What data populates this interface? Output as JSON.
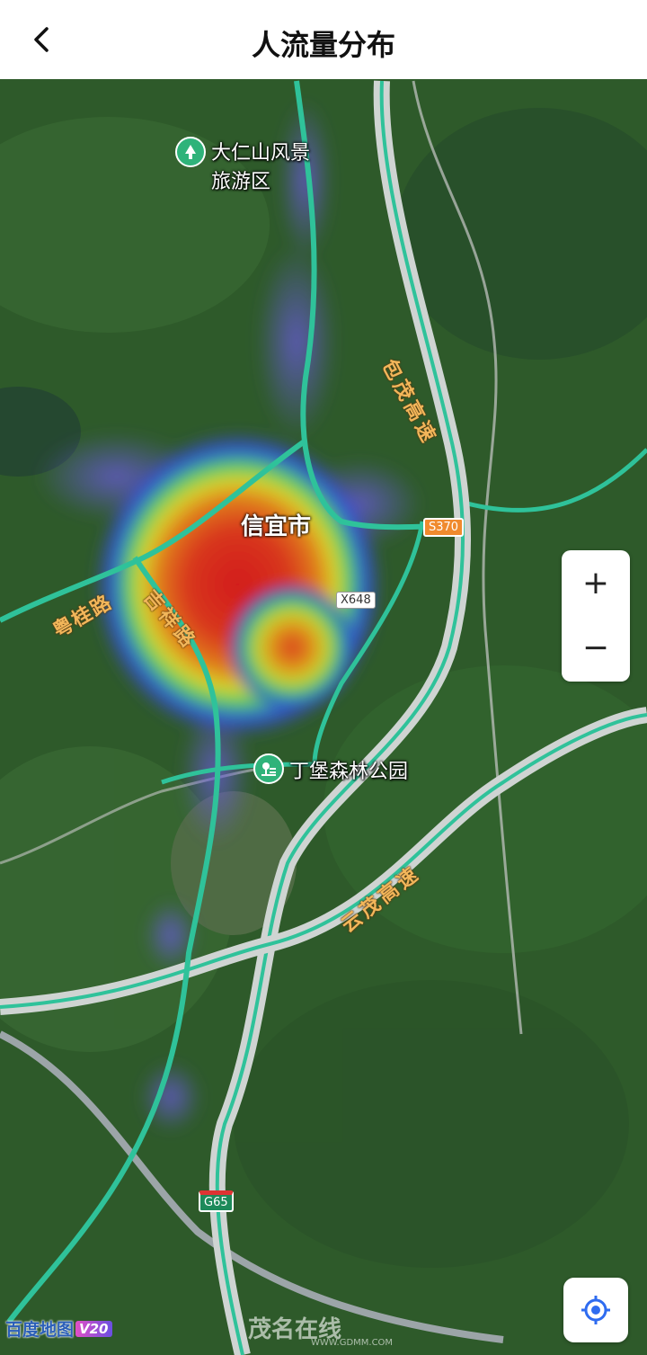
{
  "header": {
    "title": "人流量分布"
  },
  "map": {
    "poi_scenic": "大仁山风景\n旅游区",
    "poi_scenic_line1": "大仁山风景",
    "poi_scenic_line2": "旅游区",
    "poi_park": "丁堡森林公园",
    "city": "信宜市",
    "roads": {
      "baomao": "包茂高速",
      "yunmao": "云茂高速",
      "yuegui": "粤桂路",
      "jixiang": "吉祥路"
    },
    "shields": {
      "s370": "S370",
      "x648": "X648",
      "g65": "G65"
    }
  },
  "controls": {
    "zoom_in": "+",
    "zoom_out": "−"
  },
  "branding": {
    "baidu": "百度地图",
    "version": "V20",
    "watermark": "茂名在线",
    "watermark_url": "WWW.GDMM.COM"
  }
}
